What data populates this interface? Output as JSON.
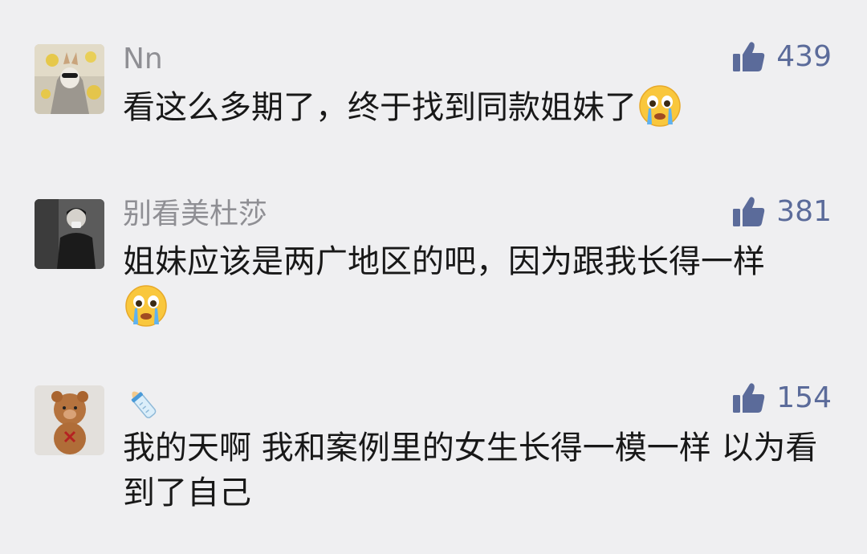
{
  "comments": [
    {
      "username": "Nn",
      "likes": "439",
      "text": "看这么多期了，终于找到同款姐妹了",
      "emoji": "crying-face-icon"
    },
    {
      "username": "别看美杜莎",
      "likes": "381",
      "text": "姐妹应该是两广地区的吧，因为跟我长得一样",
      "emoji": "crying-face-icon"
    },
    {
      "username": "",
      "username_icon": "baby-bottle-icon",
      "likes": "154",
      "text": "我的天啊 我和案例里的女生长得一模一样 以为看到了自己",
      "emoji": null
    }
  ],
  "colors": {
    "background": "#efeff1",
    "username": "#8f8f94",
    "like_icon": "#5b6b9a",
    "body_text": "#181818"
  }
}
